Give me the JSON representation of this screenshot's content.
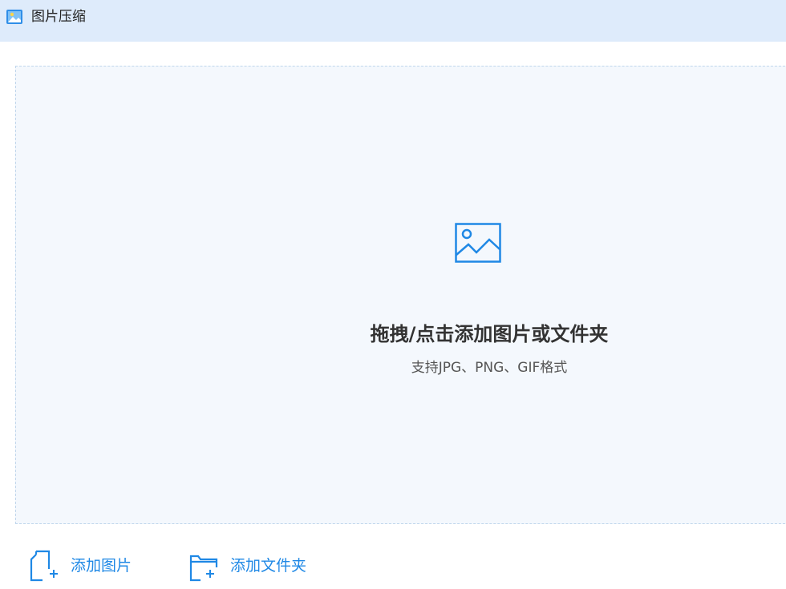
{
  "window": {
    "title": "图片压缩",
    "icon": "image-app-icon"
  },
  "dropzone": {
    "icon": "image-icon",
    "title": "拖拽/点击添加图片或文件夹",
    "subtitle": "支持JPG、PNG、GIF格式"
  },
  "actions": {
    "add_image": {
      "label": "添加图片",
      "icon": "add-file-icon"
    },
    "add_folder": {
      "label": "添加文件夹",
      "icon": "add-folder-icon"
    }
  },
  "colors": {
    "titlebar_bg": "#deebfb",
    "dropzone_bg": "#f4f8fd",
    "accent": "#1f88e5"
  }
}
